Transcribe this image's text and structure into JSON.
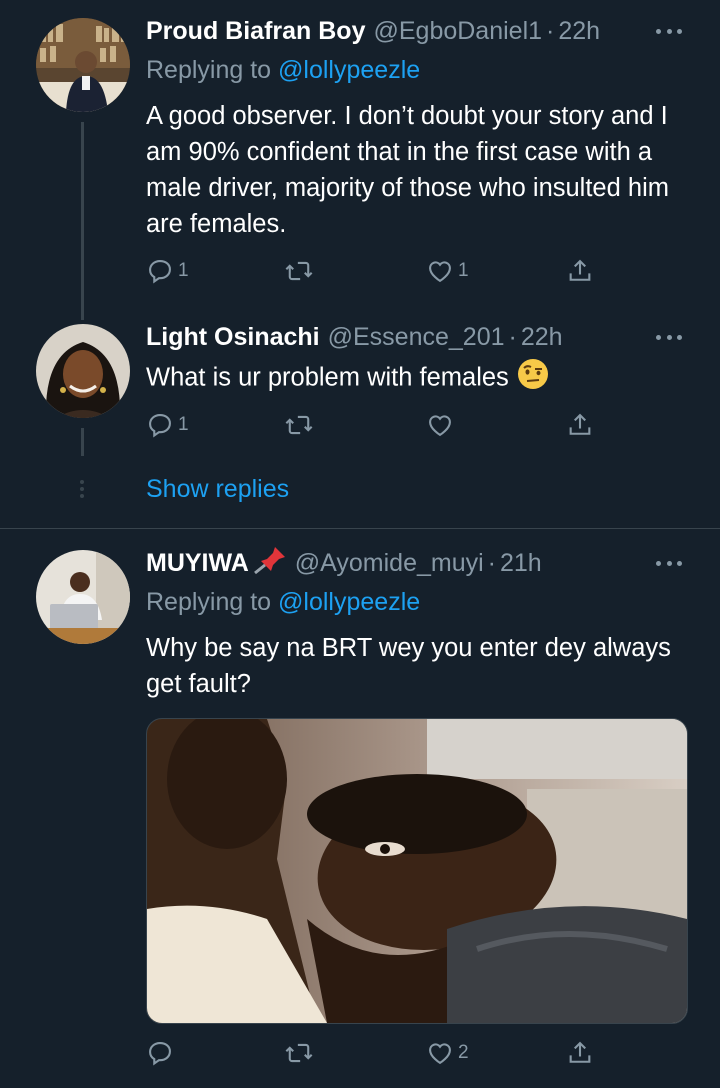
{
  "tweets": [
    {
      "name": "Proud Biafran Boy",
      "handle": "@EgboDaniel1",
      "dot": "·",
      "time": "22h",
      "replying_prefix": "Replying to",
      "replying_to": "@lollypeezle",
      "text": "A good observer. I don’t doubt your story and I am 90% confident that in the first case with a male driver, majority of those who insulted him are females.",
      "reply_count": "1",
      "retweet_count": "",
      "like_count": "1"
    },
    {
      "name": "Light Osinachi",
      "handle": "@Essence_201",
      "dot": "·",
      "time": "22h",
      "text": "What is ur problem with females",
      "emoji": "face-with-raised-eyebrow-emoji",
      "reply_count": "1",
      "retweet_count": "",
      "like_count": ""
    },
    {
      "name": "MUYIWA",
      "name_emoji": "pushpin-emoji",
      "handle": "@Ayomide_muyi",
      "dot": "·",
      "time": "21h",
      "replying_prefix": "Replying to",
      "replying_to": "@lollypeezle",
      "text": "Why be say na BRT wey you enter dey always get fault?",
      "reply_count": "",
      "retweet_count": "",
      "like_count": "2"
    }
  ],
  "show_replies": "Show replies",
  "colors": {
    "background": "#15202b",
    "secondary_text": "#8899a6",
    "link": "#1da1f2",
    "divider": "#38444d"
  }
}
